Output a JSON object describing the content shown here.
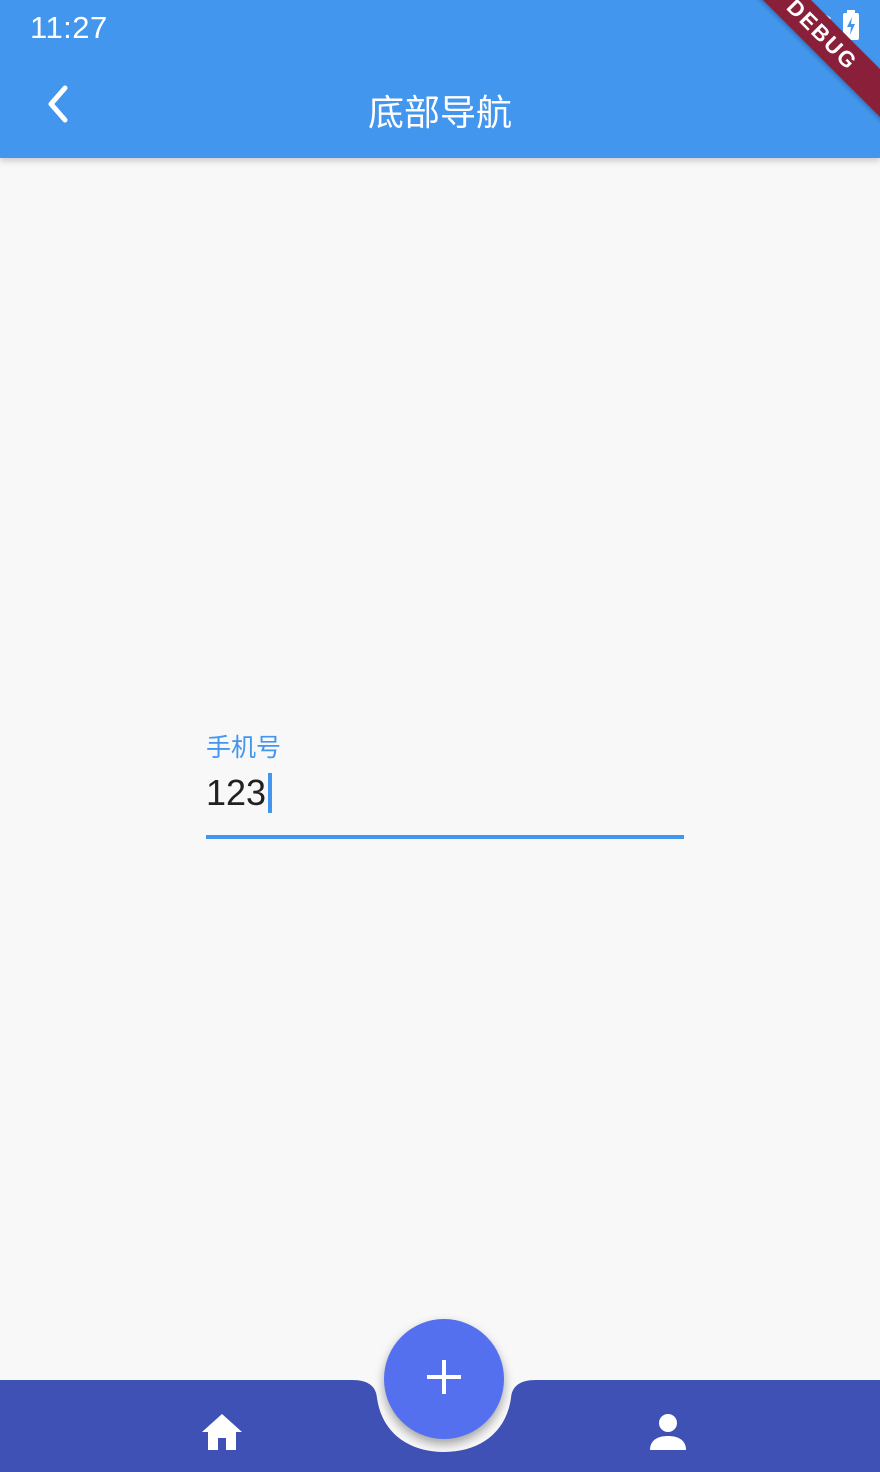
{
  "status_bar": {
    "time": "11:27",
    "icons": [
      "wifi-off-icon",
      "battery-charging-icon"
    ]
  },
  "app_bar": {
    "title": "底部导航",
    "back_icon": "chevron-left-icon"
  },
  "debug_banner": {
    "text": "DEBUG"
  },
  "form": {
    "phone_field": {
      "label": "手机号",
      "value": "123"
    }
  },
  "bottom_nav": {
    "items": [
      {
        "icon": "home-icon"
      },
      {
        "icon": "person-icon"
      }
    ],
    "fab_icon": "plus-icon"
  },
  "colors": {
    "primary": "#4396ee",
    "bottom_bar": "#3f51b5",
    "fab": "#5470ee",
    "background": "#f8f8f9",
    "debug_banner": "#8a1f3a"
  }
}
